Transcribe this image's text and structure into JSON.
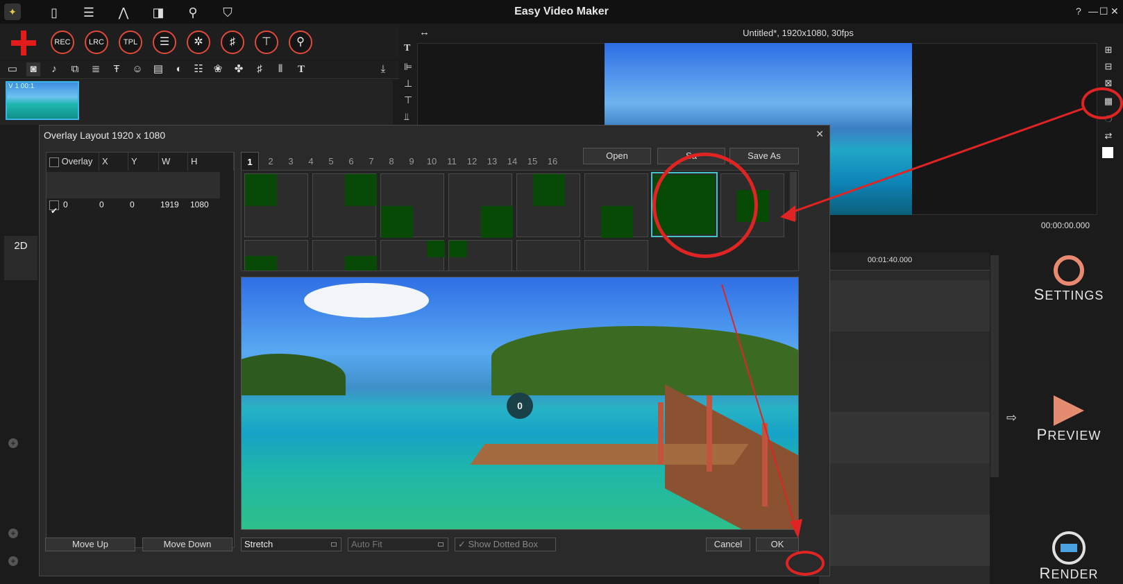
{
  "app": {
    "title": "Easy Video Maker",
    "help": "?",
    "minimize": "—",
    "maximize": "☐",
    "close": "✕"
  },
  "toolbar": {
    "circle_buttons": [
      "REC",
      "LRC",
      "TPL",
      "☰",
      "✲",
      "♯",
      "⊤",
      "⚲"
    ]
  },
  "media": {
    "thumb_label": "V 1 00:1"
  },
  "preview": {
    "title": "Untitled*, 1920x1080, 30fps",
    "timecode": "00:00:00.000",
    "expand_icon": "↔"
  },
  "timeline": {
    "ruler_label": "00:01:40.000"
  },
  "left_panel": {
    "mode": "2D"
  },
  "big_buttons": {
    "settings": {
      "first": "S",
      "rest": "ETTINGS"
    },
    "preview": {
      "first": "P",
      "rest": "REVIEW"
    },
    "render": {
      "first": "R",
      "rest": "ENDER"
    }
  },
  "dialog": {
    "title": "Overlay Layout 1920 x 1080",
    "close": "✕",
    "columns": [
      "Overlay",
      "X",
      "Y",
      "W",
      "H"
    ],
    "rows": [
      {
        "overlay": "0",
        "x": "0",
        "y": "0",
        "w": "1919",
        "h": "1080",
        "checked": true
      }
    ],
    "tabs": [
      "1",
      "2",
      "3",
      "4",
      "5",
      "6",
      "7",
      "8",
      "9",
      "10",
      "11",
      "12",
      "13",
      "14",
      "15",
      "16"
    ],
    "active_tab": "1",
    "open_label": "Open",
    "save_label": "Sa",
    "save_as_label": "Save As",
    "overlay_index": "0",
    "move_up": "Move Up",
    "move_down": "Move Down",
    "stretch": "Stretch",
    "auto_fit": "Auto Fit",
    "show_dotted_box": "Show Dotted Box",
    "cancel": "Cancel",
    "ok": "OK"
  },
  "colors": {
    "accent_red": "#e02424",
    "layout_green": "#064a06",
    "selection_cyan": "#43c5c5"
  }
}
